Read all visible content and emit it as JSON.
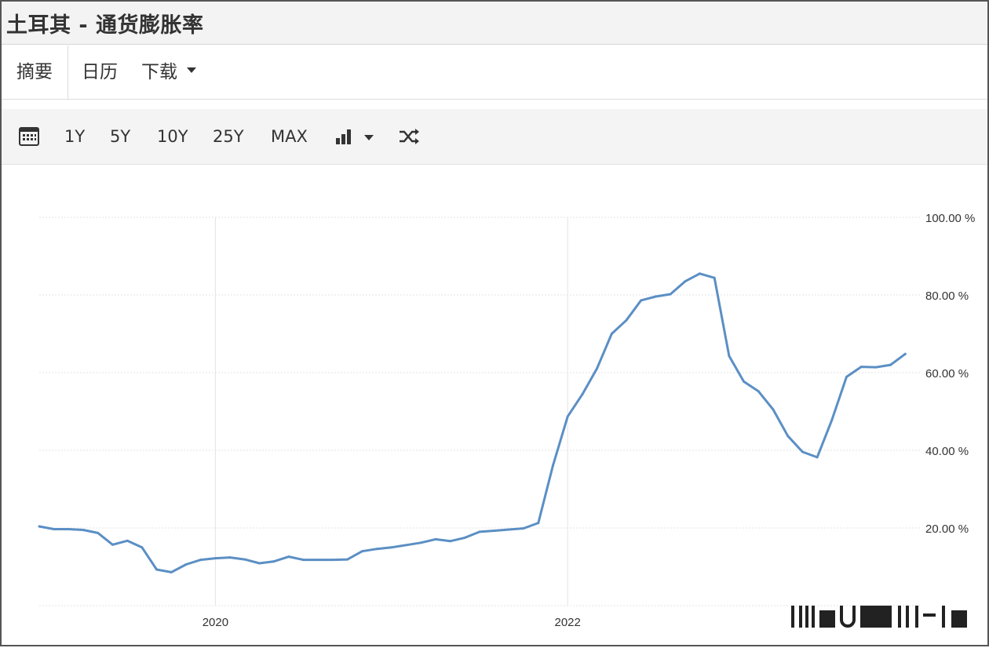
{
  "title": "土耳其 - 通货膨胀率",
  "tabs": [
    {
      "label": "摘要"
    },
    {
      "label": "日历"
    },
    {
      "label": "下载"
    }
  ],
  "toolbar": {
    "buttons": [
      "1Y",
      "5Y",
      "10Y",
      "25Y",
      "MAX"
    ],
    "icons": [
      "calendar-icon",
      "bar-chart-icon",
      "shuffle-icon"
    ]
  },
  "colors": {
    "line": "#5b8fc4",
    "grid": "#e3e3e3"
  },
  "chart_data": {
    "type": "line",
    "xlim": [
      "2019-01",
      "2024-01"
    ],
    "ylim": [
      0,
      100
    ],
    "y_ticks": [
      {
        "value": 20,
        "label": "20.00 %"
      },
      {
        "value": 40,
        "label": "40.00 %"
      },
      {
        "value": 60,
        "label": "60.00 %"
      },
      {
        "value": 80,
        "label": "80.00 %"
      },
      {
        "value": 100,
        "label": "100.00 %"
      }
    ],
    "x_ticks": [
      {
        "value": "2020-01",
        "label": "2020"
      },
      {
        "value": "2022-01",
        "label": "2022"
      }
    ],
    "axis_position": "right",
    "grid": true,
    "series": [
      {
        "x": [
          "2019-01",
          "2019-02",
          "2019-03",
          "2019-04",
          "2019-05",
          "2019-06",
          "2019-07",
          "2019-08",
          "2019-09",
          "2019-10",
          "2019-11",
          "2019-12",
          "2020-01",
          "2020-02",
          "2020-03",
          "2020-04",
          "2020-05",
          "2020-06",
          "2020-07",
          "2020-08",
          "2020-09",
          "2020-10",
          "2020-11",
          "2020-12",
          "2021-01",
          "2021-02",
          "2021-03",
          "2021-04",
          "2021-05",
          "2021-06",
          "2021-07",
          "2021-08",
          "2021-09",
          "2021-10",
          "2021-11",
          "2021-12",
          "2022-01",
          "2022-02",
          "2022-03",
          "2022-04",
          "2022-05",
          "2022-06",
          "2022-07",
          "2022-08",
          "2022-09",
          "2022-10",
          "2022-11",
          "2022-12",
          "2023-01",
          "2023-02",
          "2023-03",
          "2023-04",
          "2023-05",
          "2023-06",
          "2023-07",
          "2023-08",
          "2023-09",
          "2023-10",
          "2023-11",
          "2023-12"
        ],
        "values": [
          20.4,
          19.7,
          19.7,
          19.5,
          18.7,
          15.7,
          16.7,
          15.0,
          9.3,
          8.6,
          10.6,
          11.8,
          12.2,
          12.4,
          11.9,
          10.9,
          11.4,
          12.6,
          11.8,
          11.8,
          11.8,
          11.9,
          14.0,
          14.6,
          15.0,
          15.6,
          16.2,
          17.1,
          16.6,
          17.5,
          19.0,
          19.3,
          19.6,
          19.9,
          21.3,
          36.1,
          48.7,
          54.4,
          61.1,
          70.0,
          73.5,
          78.6,
          79.6,
          80.2,
          83.5,
          85.5,
          84.4,
          64.3,
          57.7,
          55.2,
          50.5,
          43.7,
          39.6,
          38.2,
          47.8,
          58.9,
          61.5,
          61.4,
          62.0,
          64.8
        ]
      }
    ]
  }
}
